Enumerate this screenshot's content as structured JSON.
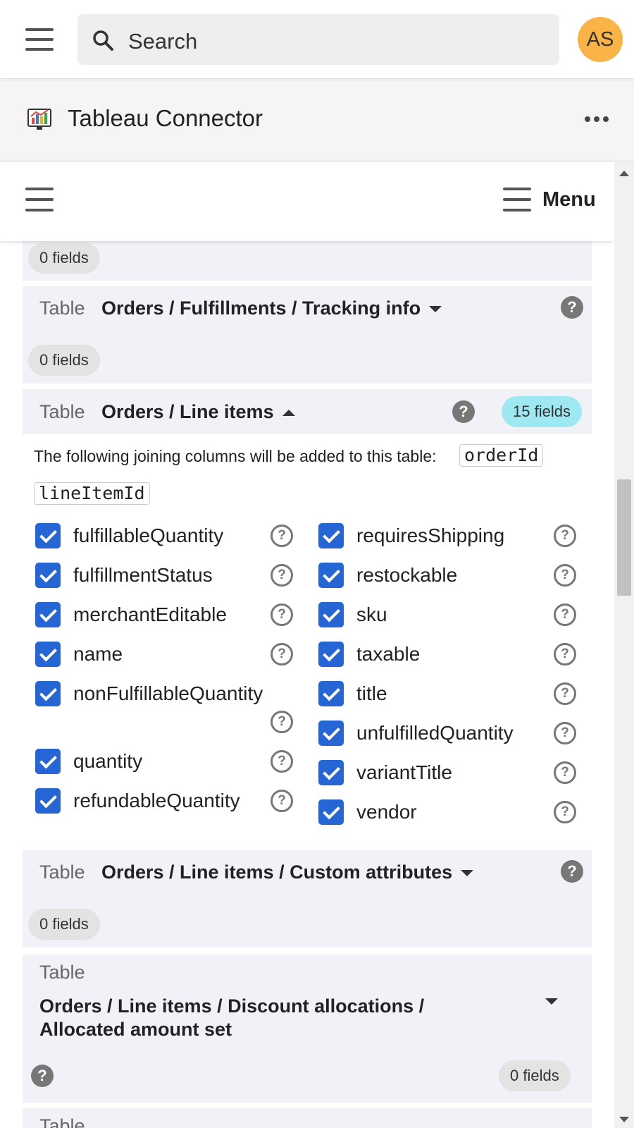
{
  "topbar": {
    "search_placeholder": "Search",
    "avatar_initials": "AS"
  },
  "app": {
    "title": "Tableau Connector"
  },
  "menubar": {
    "menu_label": "Menu"
  },
  "tables": [
    {
      "word": "Table",
      "fields_label": "0 fields"
    },
    {
      "word": "Table",
      "name": "Orders / Fulfillments / Tracking info",
      "fields_label": "0 fields",
      "expanded": false
    },
    {
      "word": "Table",
      "name": "Orders / Line items",
      "fields_label": "15 fields",
      "expanded": true,
      "join_note": "The following joining columns will be added to this table:",
      "join_columns": [
        "orderId",
        "lineItemId"
      ],
      "fields_left": [
        "fulfillableQuantity",
        "fulfillmentStatus",
        "merchantEditable",
        "name",
        "nonFulfillableQuantity",
        "quantity",
        "refundableQuantity"
      ],
      "fields_right": [
        "requiresShipping",
        "restockable",
        "sku",
        "taxable",
        "title",
        "unfulfilledQuantity",
        "variantTitle",
        "vendor"
      ]
    },
    {
      "word": "Table",
      "name": "Orders / Line items / Custom attributes",
      "fields_label": "0 fields",
      "expanded": false
    },
    {
      "word": "Table",
      "name_line1": "Orders / Line items / Discount allocations /",
      "name_line2": "Allocated amount set",
      "fields_label": "0 fields",
      "expanded": false
    },
    {
      "word": "Table"
    }
  ],
  "colors": {
    "checkbox": "#2565d4",
    "fields_chip_active": "#9ee8f2",
    "panel_bg": "#f1f2f7",
    "avatar": "#f9b346"
  }
}
